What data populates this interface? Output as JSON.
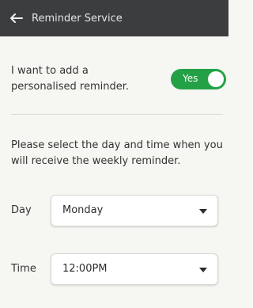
{
  "header": {
    "back_icon": "back-arrow-icon",
    "title": "Reminder Service"
  },
  "reminder": {
    "label": "I want to add a personalised reminder.",
    "toggle_label": "Yes",
    "toggle_on": true,
    "toggle_color": "#24a146"
  },
  "instructions": "Please select the day and time when you will receive the weekly reminder.",
  "day": {
    "label": "Day",
    "value": "Monday",
    "caret_icon": "caret-down-icon"
  },
  "time": {
    "label": "Time",
    "value": "12:00PM",
    "caret_icon": "caret-down-icon"
  },
  "colors": {
    "header_bg": "#3b3d3e",
    "page_bg": "#f6f6f3"
  }
}
